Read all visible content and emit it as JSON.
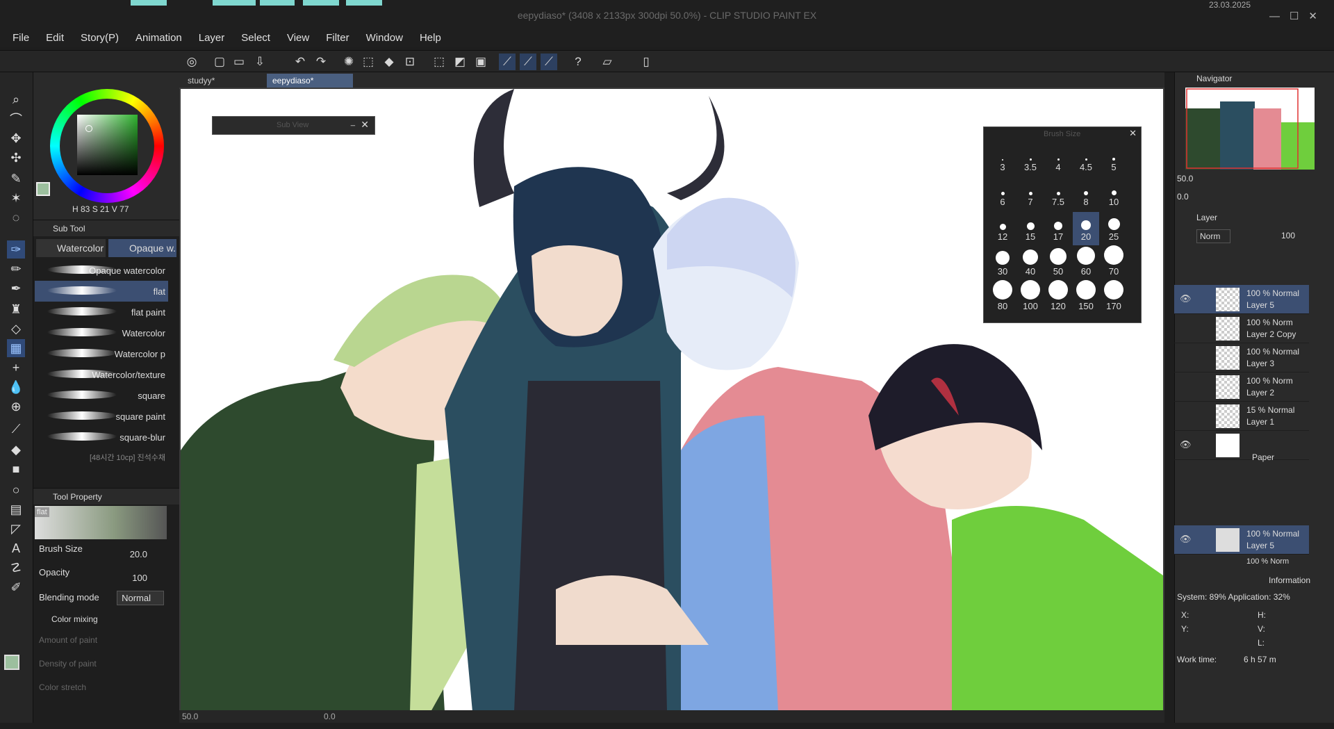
{
  "window": {
    "title": "eepydiaso* (3408 x 2133px 300dpi 50.0%)  - CLIP STUDIO PAINT EX",
    "date": "23.03.2025"
  },
  "menu": [
    "File",
    "Edit",
    "Story(P)",
    "Animation",
    "Layer",
    "Select",
    "View",
    "Filter",
    "Window",
    "Help"
  ],
  "color": {
    "h": "83",
    "s": "21",
    "v": "77",
    "main": "#9cbf9e",
    "sub": "#ffffff"
  },
  "subtool": {
    "header": "Sub Tool",
    "group1": "Watercolor",
    "group2": "Opaque w...",
    "items": [
      "Opaque watercolor",
      "flat",
      "flat paint",
      "Watercolor",
      "Watercolor p",
      "Watercolor/texture",
      "square",
      "square paint",
      "square-blur",
      "[48시간 10cp] 진석수채"
    ]
  },
  "toolprop": {
    "header": "Tool Property",
    "preview": "flat",
    "brush_size_label": "Brush Size",
    "brush_size": "20.0",
    "opacity_label": "Opacity",
    "opacity": "100",
    "blend_label": "Blending mode",
    "blend": "Normal",
    "color_mixing": "Color mixing",
    "amount": "Amount of paint",
    "density": "Density of paint",
    "stretch": "Color stretch"
  },
  "tabs": [
    "studyy*",
    "eepydiaso*"
  ],
  "subview": {
    "title": "Sub View"
  },
  "brushsize": {
    "title": "Brush Size",
    "sizes": [
      "3",
      "3.5",
      "4",
      "4.5",
      "5",
      "6",
      "7",
      "7.5",
      "8",
      "10",
      "12",
      "15",
      "17",
      "20",
      "25",
      "30",
      "40",
      "50",
      "60",
      "70",
      "80",
      "100",
      "120",
      "150",
      "170"
    ],
    "selected": "20"
  },
  "status": {
    "zoom": "50.0",
    "angle": "0.0"
  },
  "navigator": {
    "title": "Navigator",
    "zoom": "50.0",
    "angle": "0.0"
  },
  "layerpanel": {
    "title": "Layer",
    "blend": "Norm",
    "opacity": "100"
  },
  "layers": [
    {
      "mode": "100 % Normal",
      "name": "Layer 5",
      "selected": true,
      "visible": true
    },
    {
      "mode": "100 % Norm",
      "name": "Layer 2 Copy",
      "selected": false,
      "visible": false
    },
    {
      "mode": "100 % Normal",
      "name": "Layer 3",
      "selected": false,
      "visible": false
    },
    {
      "mode": "100 % Norm",
      "name": "Layer 2",
      "selected": false,
      "visible": false
    },
    {
      "mode": "15 % Normal",
      "name": "Layer 1",
      "selected": false,
      "visible": false
    },
    {
      "mode": "",
      "name": "Paper",
      "selected": false,
      "visible": true
    }
  ],
  "layer_ref": {
    "mode": "100 % Normal",
    "name": "Layer 5",
    "next": "100 % Norm"
  },
  "info": {
    "title": "Information",
    "system": "System: 89%  Application: 32%",
    "x": "X:",
    "y": "Y:",
    "h": "H:",
    "v": "V:",
    "l": "L:",
    "worktime_label": "Work time:",
    "worktime": "6 h 57 m"
  }
}
